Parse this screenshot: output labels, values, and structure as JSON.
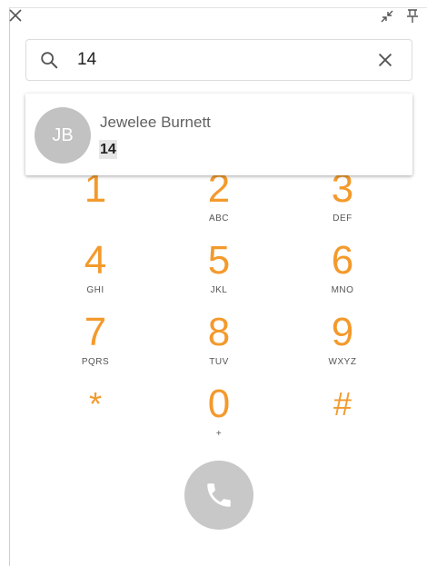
{
  "titlebar": {
    "close_icon": "close-icon",
    "shrink_icon": "shrink-icon",
    "pin_icon": "pin-icon"
  },
  "search": {
    "value": "14",
    "icon": "search-icon",
    "clear_icon": "close-icon"
  },
  "suggestion": {
    "initials": "JB",
    "name": "Jewelee Burnett",
    "number": "14"
  },
  "dialpad": {
    "keys": [
      {
        "digit": "1",
        "letters": ""
      },
      {
        "digit": "2",
        "letters": "ABC"
      },
      {
        "digit": "3",
        "letters": "DEF"
      },
      {
        "digit": "4",
        "letters": "GHI"
      },
      {
        "digit": "5",
        "letters": "JKL"
      },
      {
        "digit": "6",
        "letters": "MNO"
      },
      {
        "digit": "7",
        "letters": "PQRS"
      },
      {
        "digit": "8",
        "letters": "TUV"
      },
      {
        "digit": "9",
        "letters": "WXYZ"
      },
      {
        "digit": "*",
        "letters": ""
      },
      {
        "digit": "0",
        "letters": "+"
      },
      {
        "digit": "#",
        "letters": ""
      }
    ]
  },
  "call_button": {
    "icon": "phone-icon"
  },
  "colors": {
    "accent": "#f39a2c",
    "avatar_bg": "#c2c2c2",
    "call_button_bg": "#c8c8c8",
    "highlight_bg": "#e6e6e6"
  }
}
